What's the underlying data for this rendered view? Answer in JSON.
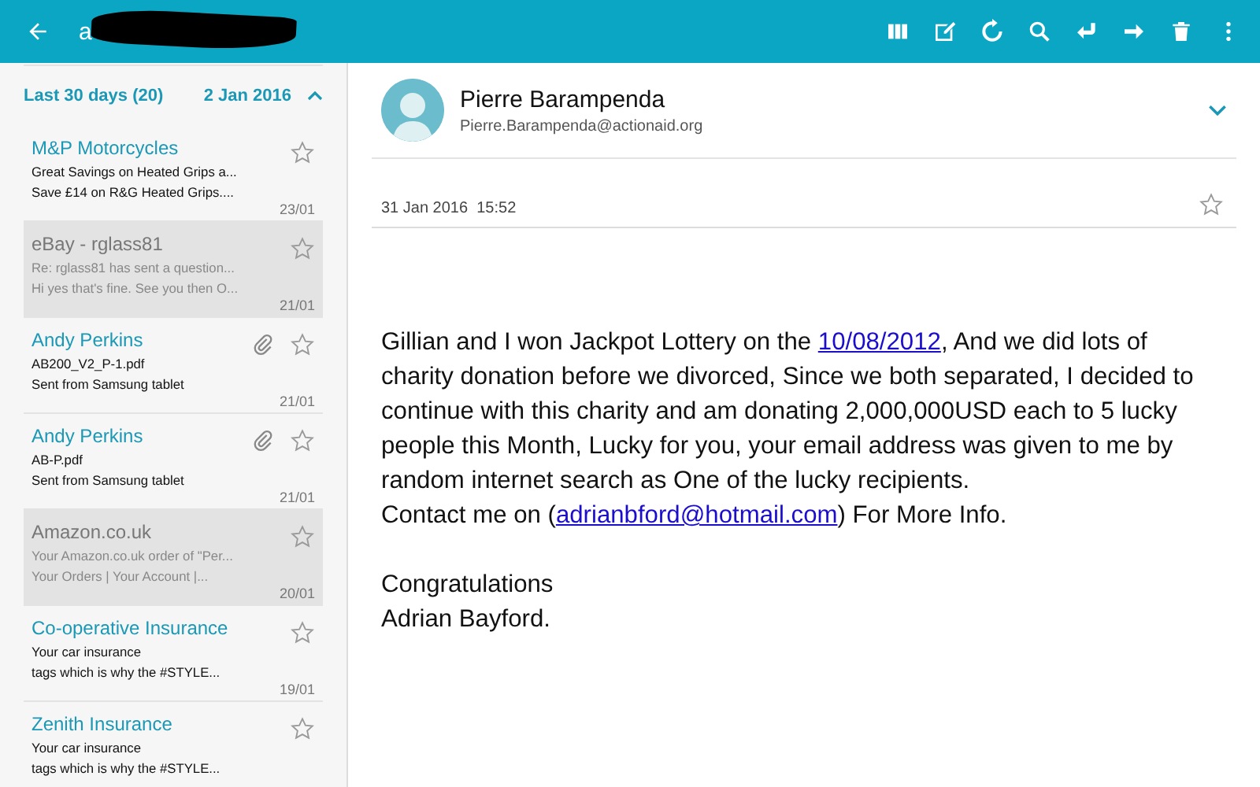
{
  "app_bar": {
    "title": "a",
    "redacted": true
  },
  "list_header": {
    "label": "Last 30 days (20)",
    "date": "2 Jan 2016",
    "expanded": true
  },
  "messages": [
    {
      "sender": "M&P Motorcycles",
      "subject": "Great Savings on Heated Grips a...",
      "preview": "Save £14 on R&G Heated Grips....",
      "date": "23/01",
      "read": false,
      "attachment": false,
      "starred": false
    },
    {
      "sender": "eBay - rglass81",
      "subject": "Re: rglass81 has sent a question...",
      "preview": "Hi yes that's fine. See you then O...",
      "date": "21/01",
      "read": true,
      "attachment": false,
      "starred": false
    },
    {
      "sender": "Andy Perkins",
      "subject": "AB200_V2_P-1.pdf",
      "preview": "Sent from Samsung tablet",
      "date": "21/01",
      "read": false,
      "attachment": true,
      "starred": false
    },
    {
      "sender": "Andy Perkins",
      "subject": "AB-P.pdf",
      "preview": "Sent from Samsung tablet",
      "date": "21/01",
      "read": false,
      "attachment": true,
      "starred": false
    },
    {
      "sender": "Amazon.co.uk",
      "subject": "Your Amazon.co.uk order of \"Per...",
      "preview": "Your Orders | Your Account |...",
      "date": "20/01",
      "read": true,
      "attachment": false,
      "starred": false
    },
    {
      "sender": "Co-operative Insurance",
      "subject": "Your car insurance",
      "preview": "tags which is why the #STYLE...",
      "date": "19/01",
      "read": false,
      "attachment": false,
      "starred": false
    },
    {
      "sender": "Zenith Insurance",
      "subject": "Your car insurance",
      "preview": "tags which is why the #STYLE...",
      "read": false,
      "attachment": false,
      "starred": false
    }
  ],
  "message": {
    "sender": "Pierre Barampenda",
    "address": "Pierre.Barampenda@actionaid.org",
    "sent": "31 Jan 2016  15:52",
    "starred": false,
    "blocks": [
      {
        "paragraphs": [
          {
            "parts": [
              {
                "kind": "text",
                "text": "Gillian  and I won Jackpot Lottery on the "
              },
              {
                "kind": "link",
                "text": "10/08/2012"
              },
              {
                "kind": "text",
                "text": ", And we did lots of charity donation before we divorced, Since we both separated, I decided to continue with this charity and am donating 2,000,000USD each to 5 lucky people this Month, Lucky for you, your email address was given to me by random internet search as One of the lucky recipients."
              }
            ]
          },
          {
            "parts": [
              {
                "kind": "text",
                "text": "Contact me on ("
              },
              {
                "kind": "link",
                "text": "adrianbford@hotmail.com"
              },
              {
                "kind": "text",
                "text": ") For More Info."
              }
            ]
          }
        ]
      },
      {
        "paragraphs": [
          {
            "parts": [
              {
                "kind": "text",
                "text": "Congratulations"
              }
            ]
          },
          {
            "parts": [
              {
                "kind": "text",
                "text": "Adrian Bayford."
              }
            ]
          }
        ]
      }
    ]
  }
}
